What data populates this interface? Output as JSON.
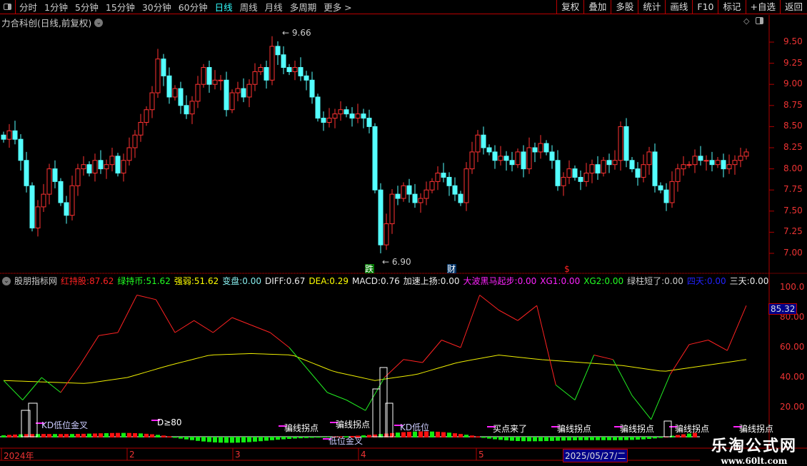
{
  "toolbar": {
    "periods": [
      "分时",
      "1分钟",
      "5分钟",
      "15分钟",
      "30分钟",
      "60分钟",
      "日线",
      "周线",
      "月线",
      "多周期",
      "更多 >"
    ],
    "active": "日线",
    "right_buttons": [
      "复权",
      "叠加",
      "多股",
      "统计",
      "画线",
      "F10",
      "标记",
      "+自选",
      "返回"
    ]
  },
  "stock": {
    "title": "力合科创(日线,前复权)"
  },
  "price_axis": [
    "9.50",
    "9.25",
    "9.00",
    "8.75",
    "8.50",
    "8.25",
    "8.00",
    "7.75",
    "7.50",
    "7.25",
    "7.00"
  ],
  "price_marks": {
    "high": "9.66",
    "low": "6.90",
    "sig1": "跌",
    "sig2": "财",
    "sig3": "$"
  },
  "indicator": {
    "name": "股朋指标网",
    "values": [
      {
        "k": "红持股:",
        "v": "87.62",
        "c": "#f22"
      },
      {
        "k": "绿持币:",
        "v": "51.62",
        "c": "#2f2"
      },
      {
        "k": "强弱:",
        "v": "51.62",
        "c": "#ff0"
      },
      {
        "k": "变盘:",
        "v": "0.00",
        "c": "#8ee"
      },
      {
        "k": "DIFF:",
        "v": "0.67",
        "c": "#eee"
      },
      {
        "k": "DEA:",
        "v": "0.29",
        "c": "#ff0"
      },
      {
        "k": "MACD:",
        "v": "0.76",
        "c": "#eee"
      },
      {
        "k": "加速上扬:",
        "v": "0.00",
        "c": "#eee"
      },
      {
        "k": "大波黑马起步:",
        "v": "0.00",
        "c": "#f2f"
      },
      {
        "k": "XG1:",
        "v": "0.00",
        "c": "#f2f"
      },
      {
        "k": "XG2:",
        "v": "0.00",
        "c": "#2f2"
      },
      {
        "k": "绿柱短了:",
        "v": "0.00",
        "c": "#ccc"
      },
      {
        "k": "四天:",
        "v": "0.00",
        "c": "#22f"
      },
      {
        "k": "三天:",
        "v": "0.00",
        "c": "#eee"
      }
    ],
    "axis": [
      "100.0",
      "80.00",
      "60.00",
      "40.00",
      "20.00"
    ],
    "current": "85.32",
    "signals": [
      "KD低位金叉",
      "D≥80",
      "骗线拐点",
      "骗线拐点",
      "KD低位",
      "低位金叉",
      "买点来了",
      "骗线拐点",
      "骗线拐点",
      "骗线拐点",
      "骗线拐点"
    ]
  },
  "date_axis": {
    "labels": [
      "2024年",
      "2",
      "3",
      "4",
      "5"
    ],
    "cursor": "2025/05/27/二"
  },
  "watermark": {
    "name": "乐淘公式网",
    "url": "www.60lt.com"
  },
  "colors": {
    "up": "#ff3232",
    "down": "#54ffff",
    "frame": "#b00000"
  },
  "chart_data": {
    "type": "candlestick",
    "note": "approximate daily closes, read from chart",
    "ylim": [
      6.8,
      9.75
    ],
    "close": [
      8.35,
      8.45,
      8.35,
      8.1,
      7.8,
      7.3,
      7.55,
      7.7,
      8.0,
      7.85,
      7.6,
      7.45,
      7.8,
      8.0,
      8.05,
      7.95,
      8.1,
      8.0,
      8.05,
      8.15,
      7.95,
      8.1,
      8.25,
      8.4,
      8.55,
      8.7,
      8.9,
      9.3,
      9.1,
      8.85,
      8.95,
      8.75,
      8.65,
      8.8,
      9.0,
      9.2,
      9.0,
      9.05,
      9.05,
      8.7,
      8.9,
      8.95,
      8.85,
      9.0,
      9.15,
      9.2,
      9.05,
      9.45,
      9.35,
      9.2,
      9.15,
      9.2,
      9.1,
      9.05,
      8.85,
      8.6,
      8.55,
      8.6,
      8.65,
      8.7,
      8.65,
      8.6,
      8.65,
      8.6,
      8.5,
      7.75,
      7.1,
      7.35,
      7.7,
      7.65,
      7.8,
      7.7,
      7.6,
      7.65,
      7.75,
      7.85,
      7.95,
      7.9,
      7.8,
      7.7,
      7.6,
      8.0,
      8.2,
      8.4,
      8.25,
      8.2,
      8.1,
      8.15,
      8.1,
      8.05,
      8.2,
      8.0,
      8.25,
      8.2,
      8.3,
      8.2,
      8.1,
      7.8,
      7.9,
      8.0,
      7.9,
      7.85,
      7.95,
      8.05,
      7.95,
      8.1,
      8.05,
      8.1,
      8.5,
      8.1,
      8.0,
      7.9,
      8.05,
      8.2,
      7.8,
      7.75,
      7.6,
      7.85,
      8.0,
      8.05,
      8.05,
      8.15,
      8.1,
      8.1,
      8.05,
      8.1,
      8.0,
      8.05,
      8.1,
      8.15,
      8.2
    ],
    "indicator_red": [
      38,
      25,
      40,
      30,
      48,
      68,
      70,
      95,
      92,
      70,
      78,
      70,
      80,
      75,
      70,
      60,
      45,
      30,
      25,
      18,
      40,
      52,
      50,
      65,
      60,
      95,
      85,
      78,
      88,
      35,
      25,
      55,
      52,
      28,
      12,
      42,
      62,
      65,
      58,
      88
    ],
    "indicator_yellow": [
      38,
      37,
      36,
      40,
      48,
      55,
      56,
      55,
      44,
      38,
      42,
      50,
      55,
      52,
      50,
      48,
      44,
      48,
      52
    ],
    "ylim_indicator": [
      10,
      104
    ]
  }
}
